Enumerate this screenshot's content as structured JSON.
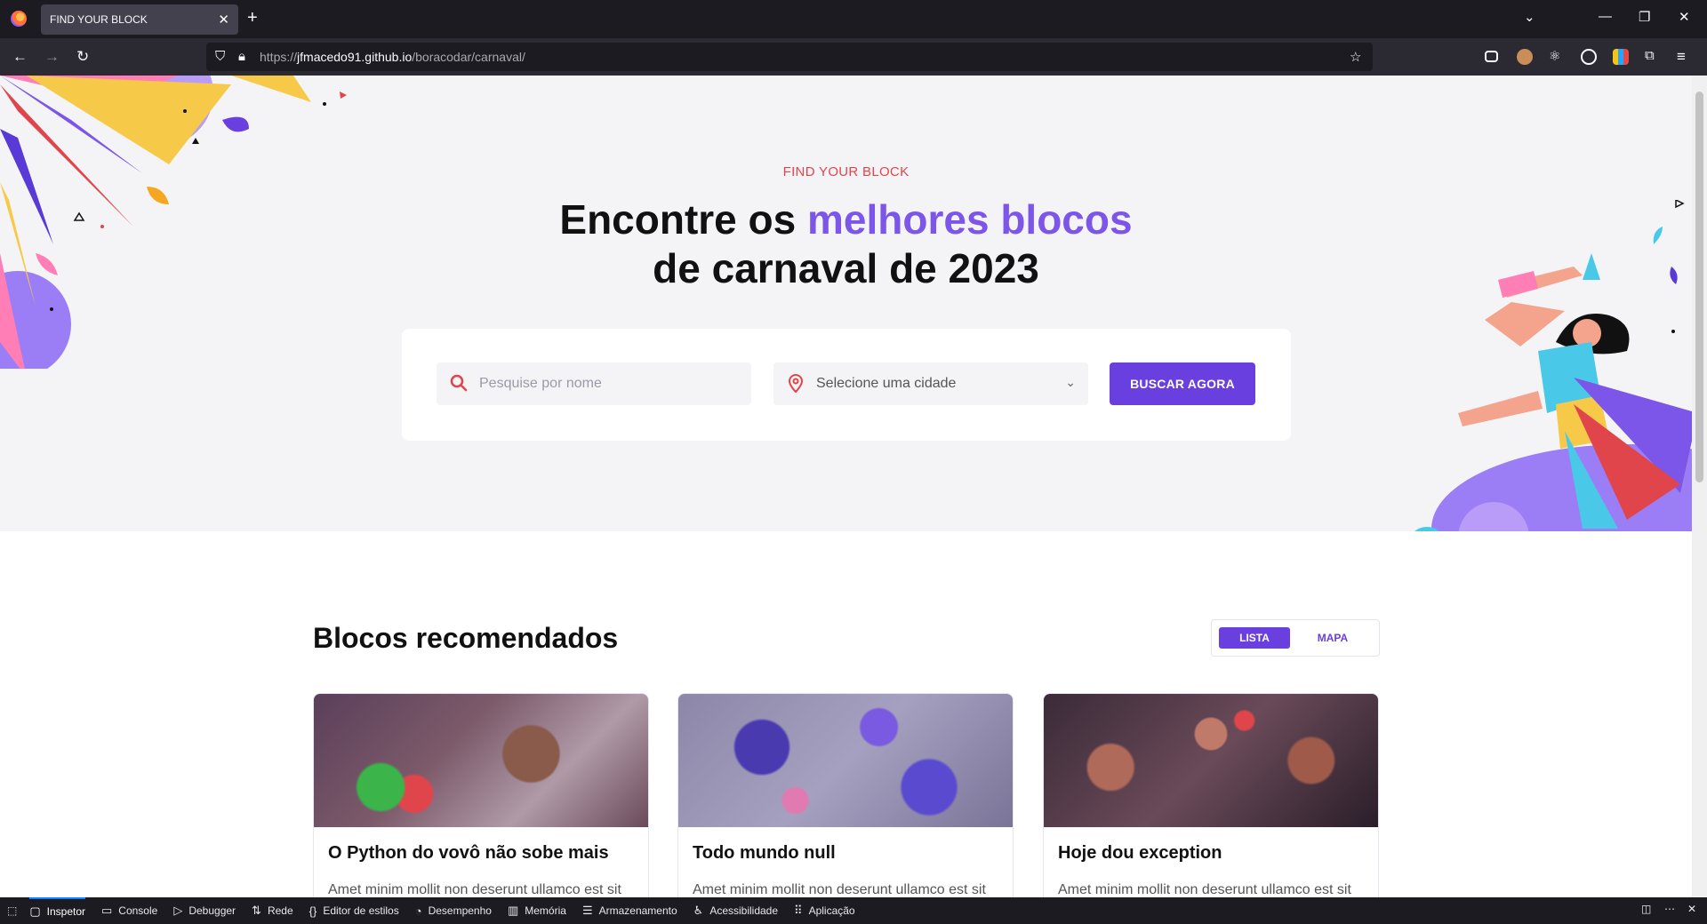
{
  "browser": {
    "tab_title": "FIND YOUR BLOCK",
    "url_prefix": "https://",
    "url_host": "jfmacedo91.github.io",
    "url_path": "/boracodar/carnaval/"
  },
  "hero": {
    "tag": "FIND YOUR BLOCK",
    "title_part1": "Encontre os ",
    "title_accent": "melhores blocos",
    "title_line2": "de carnaval de 2023"
  },
  "search": {
    "name_placeholder": "Pesquise por nome",
    "city_placeholder": "Selecione uma cidade",
    "button_label": "BUSCAR AGORA"
  },
  "recommended": {
    "title": "Blocos recomendados",
    "toggle_list": "LISTA",
    "toggle_map": "MAPA",
    "cards": [
      {
        "title": "O Python do vovô não sobe mais",
        "desc": "Amet minim mollit non deserunt ullamco est sit"
      },
      {
        "title": "Todo mundo null",
        "desc": "Amet minim mollit non deserunt ullamco est sit"
      },
      {
        "title": "Hoje dou exception",
        "desc": "Amet minim mollit non deserunt ullamco est sit"
      }
    ]
  },
  "devtools": {
    "items": [
      "Inspetor",
      "Console",
      "Debugger",
      "Rede",
      "Editor de estilos",
      "Desempenho",
      "Memória",
      "Armazenamento",
      "Acessibilidade",
      "Aplicação"
    ]
  },
  "colors": {
    "accent": "#6a3fe0",
    "title_accent": "#7c56e8",
    "tag": "#e0454b"
  }
}
